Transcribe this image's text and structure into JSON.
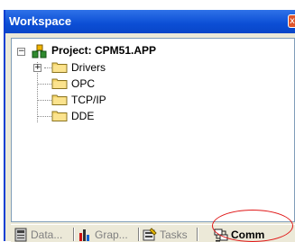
{
  "window": {
    "title": "Workspace",
    "close_glyph": "x"
  },
  "tree": {
    "project": {
      "label": "Project: CPM51.APP",
      "icon": "project-icon",
      "expander": "−"
    },
    "items": [
      {
        "label": "Drivers",
        "icon": "folder-icon",
        "expander": "+"
      },
      {
        "label": "OPC",
        "icon": "folder-icon"
      },
      {
        "label": "TCP/IP",
        "icon": "folder-icon"
      },
      {
        "label": "DDE",
        "icon": "folder-icon"
      }
    ]
  },
  "tabs": [
    {
      "label": "Data...",
      "icon": "database-icon",
      "active": false
    },
    {
      "label": "Grap...",
      "icon": "graph-icon",
      "active": false
    },
    {
      "label": "Tasks",
      "icon": "tasks-icon",
      "active": false
    },
    {
      "label": "Comm",
      "icon": "communication-icon",
      "active": true
    }
  ],
  "colors": {
    "title_bar": "#0b4ed5",
    "highlight_circle": "#e01818",
    "folder": "#f4d56a"
  }
}
